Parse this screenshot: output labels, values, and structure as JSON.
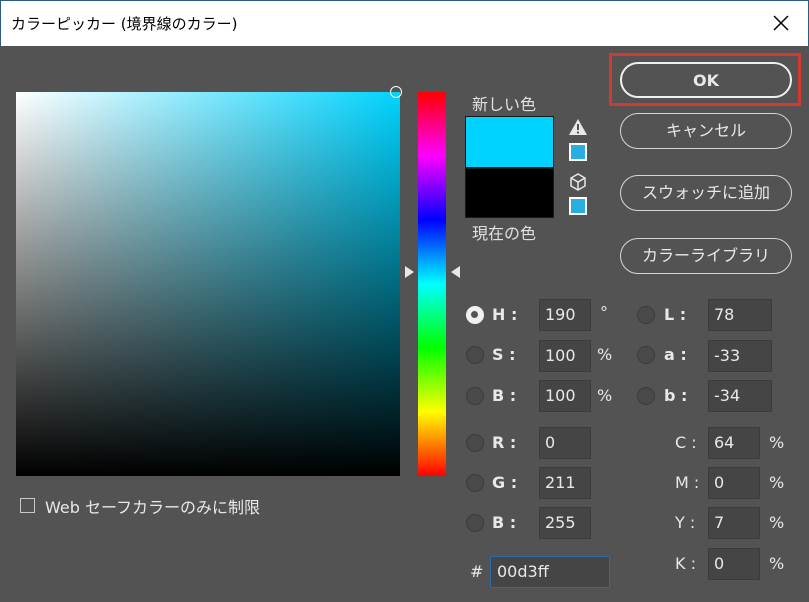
{
  "window": {
    "title": "カラーピッカー (境界線のカラー)"
  },
  "preview": {
    "new_label": "新しい色",
    "current_label": "現在の色",
    "new_color": "#00d3ff",
    "current_color": "#000000"
  },
  "buttons": {
    "ok": "OK",
    "cancel": "キャンセル",
    "add_swatch": "スウォッチに追加",
    "libraries": "カラーライブラリ"
  },
  "fields": {
    "h": {
      "label": "H :",
      "value": "190",
      "unit": "°"
    },
    "s": {
      "label": "S :",
      "value": "100",
      "unit": "%"
    },
    "b": {
      "label": "B :",
      "value": "100",
      "unit": "%"
    },
    "r": {
      "label": "R :",
      "value": "0"
    },
    "g": {
      "label": "G :",
      "value": "211"
    },
    "b2": {
      "label": "B :",
      "value": "255"
    },
    "l": {
      "label": "L :",
      "value": "78"
    },
    "a": {
      "label": "a :",
      "value": "-33"
    },
    "lab_b": {
      "label": "b :",
      "value": "-34"
    },
    "c": {
      "label": "C :",
      "value": "64",
      "unit": "%"
    },
    "m": {
      "label": "M :",
      "value": "0",
      "unit": "%"
    },
    "y": {
      "label": "Y :",
      "value": "7",
      "unit": "%"
    },
    "k": {
      "label": "K :",
      "value": "0",
      "unit": "%"
    }
  },
  "hex": {
    "label": "#",
    "value": "00d3ff"
  },
  "web_safe": {
    "label": "Web セーフカラーのみに制限",
    "checked": false
  },
  "icons": {
    "close": "close-icon",
    "warning": "warning-icon",
    "cube": "cube-icon"
  },
  "colors": {
    "highlight": "#d33a2f",
    "background": "#535353"
  }
}
